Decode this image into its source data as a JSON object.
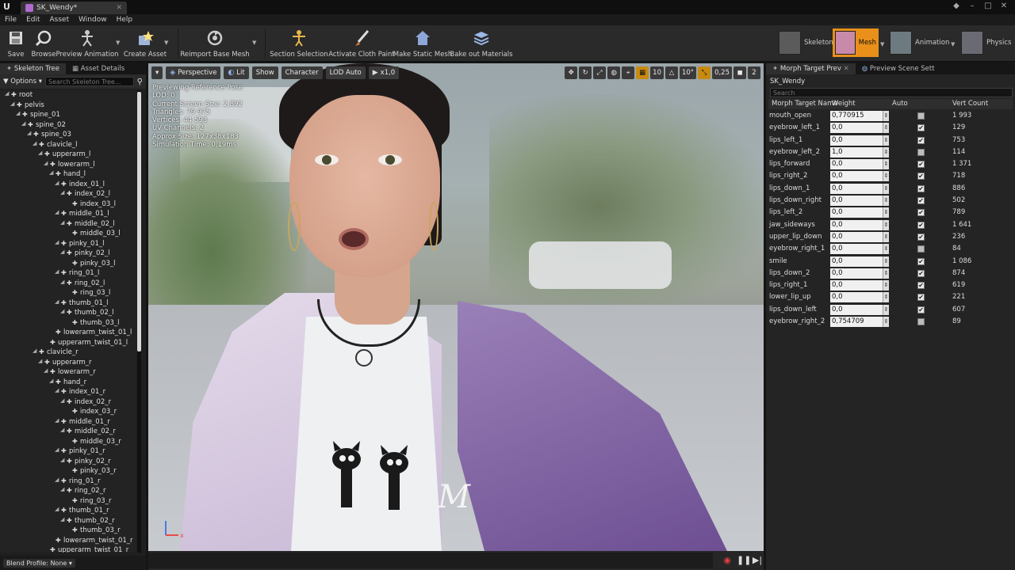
{
  "window": {
    "tab_title": "SK_Wendy*",
    "logo": "U"
  },
  "menu": [
    "File",
    "Edit",
    "Asset",
    "Window",
    "Help"
  ],
  "toolbar": {
    "buttons": [
      {
        "label": "Save",
        "icon": "save-icon"
      },
      {
        "label": "Browse",
        "icon": "browse-icon"
      },
      {
        "label": "Preview Animation",
        "icon": "preview-animation-icon"
      },
      {
        "label": "Create Asset",
        "icon": "create-asset-icon"
      },
      {
        "label": "Reimport Base Mesh",
        "icon": "reimport-icon"
      },
      {
        "label": "Section Selection",
        "icon": "section-selection-icon"
      },
      {
        "label": "Activate Cloth Paint",
        "icon": "cloth-paint-icon"
      },
      {
        "label": "Make Static Mesh",
        "icon": "static-mesh-icon"
      },
      {
        "label": "Bake out Materials",
        "icon": "bake-materials-icon"
      }
    ],
    "modes": [
      {
        "label": "Skeleton"
      },
      {
        "label": "Mesh"
      },
      {
        "label": "Animation"
      },
      {
        "label": "Physics"
      }
    ],
    "accent": "#e8901a"
  },
  "left_panel": {
    "tabs": [
      "Skeleton Tree",
      "Asset Details"
    ],
    "options_label": "Options",
    "search_placeholder": "Search Skeleton Tree...",
    "blend_profile": "Blend Profile: None",
    "bones": [
      {
        "name": "root",
        "depth": 0
      },
      {
        "name": "pelvis",
        "depth": 1
      },
      {
        "name": "spine_01",
        "depth": 2
      },
      {
        "name": "spine_02",
        "depth": 3
      },
      {
        "name": "spine_03",
        "depth": 4
      },
      {
        "name": "clavicle_l",
        "depth": 5
      },
      {
        "name": "upperarm_l",
        "depth": 6
      },
      {
        "name": "lowerarm_l",
        "depth": 7
      },
      {
        "name": "hand_l",
        "depth": 8
      },
      {
        "name": "index_01_l",
        "depth": 9
      },
      {
        "name": "index_02_l",
        "depth": 10
      },
      {
        "name": "index_03_l",
        "depth": 11
      },
      {
        "name": "middle_01_l",
        "depth": 9
      },
      {
        "name": "middle_02_l",
        "depth": 10
      },
      {
        "name": "middle_03_l",
        "depth": 11
      },
      {
        "name": "pinky_01_l",
        "depth": 9
      },
      {
        "name": "pinky_02_l",
        "depth": 10
      },
      {
        "name": "pinky_03_l",
        "depth": 11
      },
      {
        "name": "ring_01_l",
        "depth": 9
      },
      {
        "name": "ring_02_l",
        "depth": 10
      },
      {
        "name": "ring_03_l",
        "depth": 11
      },
      {
        "name": "thumb_01_l",
        "depth": 9
      },
      {
        "name": "thumb_02_l",
        "depth": 10
      },
      {
        "name": "thumb_03_l",
        "depth": 11
      },
      {
        "name": "lowerarm_twist_01_l",
        "depth": 8
      },
      {
        "name": "upperarm_twist_01_l",
        "depth": 7
      },
      {
        "name": "clavicle_r",
        "depth": 5
      },
      {
        "name": "upperarm_r",
        "depth": 6
      },
      {
        "name": "lowerarm_r",
        "depth": 7
      },
      {
        "name": "hand_r",
        "depth": 8
      },
      {
        "name": "index_01_r",
        "depth": 9
      },
      {
        "name": "index_02_r",
        "depth": 10
      },
      {
        "name": "index_03_r",
        "depth": 11
      },
      {
        "name": "middle_01_r",
        "depth": 9
      },
      {
        "name": "middle_02_r",
        "depth": 10
      },
      {
        "name": "middle_03_r",
        "depth": 11
      },
      {
        "name": "pinky_01_r",
        "depth": 9
      },
      {
        "name": "pinky_02_r",
        "depth": 10
      },
      {
        "name": "pinky_03_r",
        "depth": 11
      },
      {
        "name": "ring_01_r",
        "depth": 9
      },
      {
        "name": "ring_02_r",
        "depth": 10
      },
      {
        "name": "ring_03_r",
        "depth": 11
      },
      {
        "name": "thumb_01_r",
        "depth": 9
      },
      {
        "name": "thumb_02_r",
        "depth": 10
      },
      {
        "name": "thumb_03_r",
        "depth": 11
      },
      {
        "name": "lowerarm_twist_01_r",
        "depth": 8
      },
      {
        "name": "upperarm_twist_01_r",
        "depth": 7
      }
    ]
  },
  "viewport": {
    "perspective": "Perspective",
    "lit": "Lit",
    "show": "Show",
    "character": "Character",
    "lod": "LOD Auto",
    "speed": "x1,0",
    "grid_snap": "10",
    "rot_snap": "10°",
    "scale_snap": "0,25",
    "cam_speed": "2",
    "stats": [
      "Previewing Reference Pose",
      "LOD: 0",
      "Current Screen Size: 2,892",
      "Triangles: 79 975",
      "Vertices: 44 593",
      "UV Channels: 2",
      "Approx Size: 127x38x183",
      "Simulation Time: 0,19ms"
    ],
    "hoodie_letter": "M"
  },
  "right_panel": {
    "tabs": [
      "Morph Target Prev",
      "Preview Scene Sett"
    ],
    "mesh_name": "SK_Wendy",
    "search_placeholder": "Search",
    "headers": {
      "name": "Morph Target Name",
      "weight": "Weight",
      "auto": "Auto",
      "vert_count": "Vert Count"
    },
    "rows": [
      {
        "name": "mouth_open",
        "weight": "0,770915",
        "auto": false,
        "vert_count": "1 993"
      },
      {
        "name": "eyebrow_left_1",
        "weight": "0,0",
        "auto": true,
        "vert_count": "129"
      },
      {
        "name": "lips_left_1",
        "weight": "0,0",
        "auto": true,
        "vert_count": "753"
      },
      {
        "name": "eyebrow_left_2",
        "weight": "1,0",
        "auto": false,
        "vert_count": "114"
      },
      {
        "name": "lips_forward",
        "weight": "0,0",
        "auto": true,
        "vert_count": "1 371"
      },
      {
        "name": "lips_right_2",
        "weight": "0,0",
        "auto": true,
        "vert_count": "718"
      },
      {
        "name": "lips_down_1",
        "weight": "0,0",
        "auto": true,
        "vert_count": "886"
      },
      {
        "name": "lips_down_right",
        "weight": "0,0",
        "auto": true,
        "vert_count": "502"
      },
      {
        "name": "lips_left_2",
        "weight": "0,0",
        "auto": true,
        "vert_count": "789"
      },
      {
        "name": "jaw_sideways",
        "weight": "0,0",
        "auto": true,
        "vert_count": "1 641"
      },
      {
        "name": "upper_lip_down",
        "weight": "0,0",
        "auto": true,
        "vert_count": "236"
      },
      {
        "name": "eyebrow_right_1",
        "weight": "0,0",
        "auto": false,
        "vert_count": "84"
      },
      {
        "name": "smile",
        "weight": "0,0",
        "auto": true,
        "vert_count": "1 086"
      },
      {
        "name": "lips_down_2",
        "weight": "0,0",
        "auto": true,
        "vert_count": "874"
      },
      {
        "name": "lips_right_1",
        "weight": "0,0",
        "auto": true,
        "vert_count": "619"
      },
      {
        "name": "lower_lip_up",
        "weight": "0,0",
        "auto": true,
        "vert_count": "221"
      },
      {
        "name": "lips_down_left",
        "weight": "0,0",
        "auto": true,
        "vert_count": "607"
      },
      {
        "name": "eyebrow_right_2",
        "weight": "0,754709",
        "auto": false,
        "vert_count": "89"
      }
    ]
  }
}
